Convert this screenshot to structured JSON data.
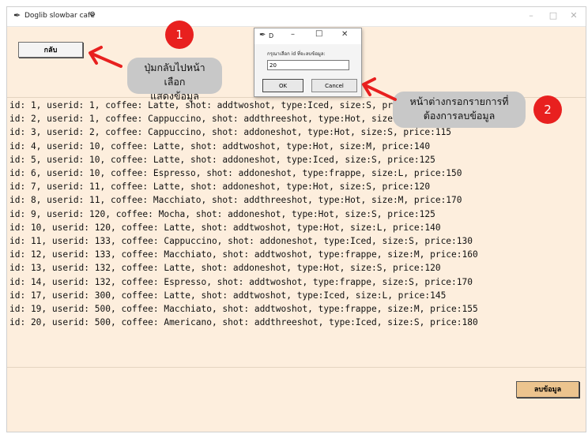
{
  "window": {
    "title": "Doglib slowbar cafe",
    "controls": {
      "minimize": "–",
      "maximize": "□",
      "close": "✕"
    }
  },
  "toolbar": {
    "back_label": "กลับ"
  },
  "records": [
    "id: 1, userid: 1, coffee: Latte, shot: addtwoshot, type:Iced, size:S, price:125",
    "id: 2, userid: 1, coffee: Cappuccino, shot: addthreeshot, type:Hot, size:M, price:130",
    "id: 3, userid: 2, coffee: Cappuccino, shot: addoneshot, type:Hot, size:S, price:115",
    "id: 4, userid: 10, coffee: Latte, shot: addtwoshot, type:Hot, size:M, price:140",
    "id: 5, userid: 10, coffee: Latte, shot: addoneshot, type:Iced, size:S, price:125",
    "id: 6, userid: 10, coffee: Espresso, shot: addoneshot, type:frappe, size:L, price:150",
    "id: 7, userid: 11, coffee: Latte, shot: addoneshot, type:Hot, size:S, price:120",
    "id: 8, userid: 11, coffee: Macchiato, shot: addthreeshot, type:Hot, size:M, price:170",
    "id: 9, userid: 120, coffee: Mocha, shot: addoneshot, type:Hot, size:S, price:125",
    "id: 10, userid: 120, coffee: Latte, shot: addtwoshot, type:Hot, size:L, price:140",
    "id: 11, userid: 133, coffee: Cappuccino, shot: addoneshot, type:Iced, size:S, price:130",
    "id: 12, userid: 133, coffee: Macchiato, shot: addtwoshot, type:frappe, size:M, price:160",
    "id: 13, userid: 132, coffee: Latte, shot: addoneshot, type:Hot, size:S, price:120",
    "id: 14, userid: 132, coffee: Espresso, shot: addtwoshot, type:frappe, size:S, price:170",
    "id: 17, userid: 300, coffee: Latte, shot: addtwoshot, type:Iced, size:L, price:145",
    "id: 19, userid: 500, coffee: Macchiato, shot: addtwoshot, type:frappe, size:M, price:155",
    "id: 20, userid: 500, coffee: Americano, shot: addthreeshot, type:Iced, size:S, price:180"
  ],
  "footer": {
    "delete_label": "ลบข้อมูล"
  },
  "dialog": {
    "title": "D",
    "controls": {
      "minimize": "–",
      "maximize": "□",
      "close": "✕"
    },
    "prompt": "กรุณาเลือก id ที่จะลบข้อมูล:",
    "input_value": "20",
    "ok_label": "OK",
    "cancel_label": "Cancel"
  },
  "annotations": {
    "badge1": "1",
    "badge2": "2",
    "callout1_line1": "ปุ่มกลับไปหน้าเลือก",
    "callout1_line2": "แสดงข้อมูล",
    "callout2_line1": "หน้าต่างกรอกรายการที่",
    "callout2_line2": "ต้องการลบข้อมูล"
  },
  "colors": {
    "window_bg": "#fdeedd",
    "delete_button_bg": "#ecc48e",
    "badge_red": "#e8201f",
    "callout_gray": "#c8c8c8",
    "arrow_red": "#e8201f"
  },
  "icons": {
    "app": "feather-icon",
    "title_extra": "gear-icon"
  }
}
